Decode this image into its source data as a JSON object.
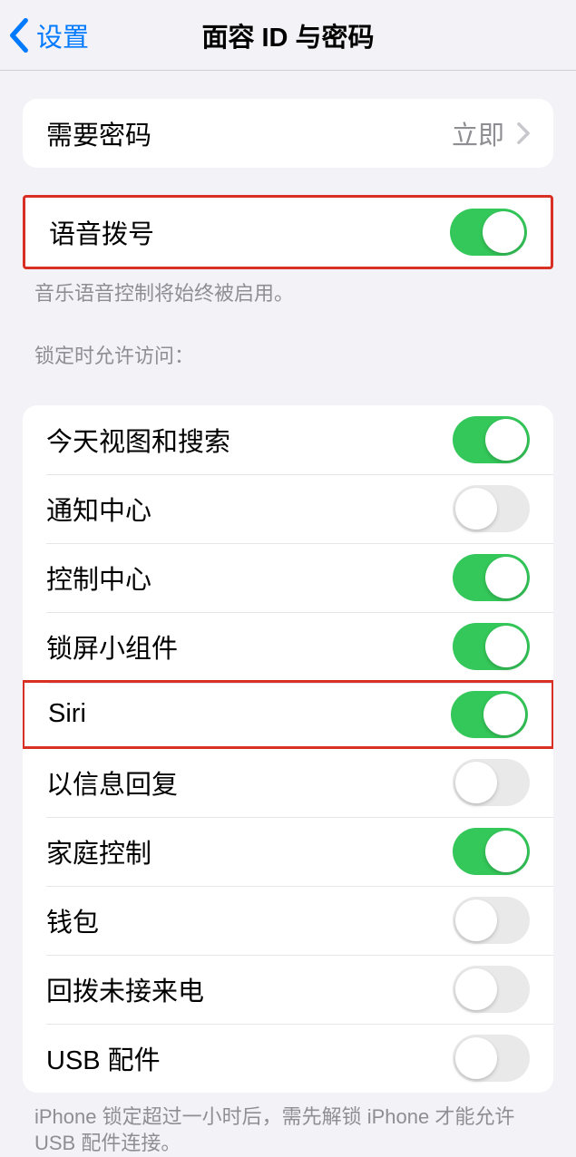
{
  "nav": {
    "back_label": "设置",
    "title": "面容 ID 与密码"
  },
  "require_passcode": {
    "label": "需要密码",
    "value": "立即"
  },
  "voice_dial": {
    "label": "语音拨号",
    "on": true,
    "footer": "音乐语音控制将始终被启用。"
  },
  "lock_access": {
    "header": "锁定时允许访问：",
    "items": [
      {
        "label": "今天视图和搜索",
        "on": true
      },
      {
        "label": "通知中心",
        "on": false
      },
      {
        "label": "控制中心",
        "on": true
      },
      {
        "label": "锁屏小组件",
        "on": true
      },
      {
        "label": "Siri",
        "on": true
      },
      {
        "label": "以信息回复",
        "on": false
      },
      {
        "label": "家庭控制",
        "on": true
      },
      {
        "label": "钱包",
        "on": false
      },
      {
        "label": "回拨未接来电",
        "on": false
      },
      {
        "label": "USB 配件",
        "on": false
      }
    ],
    "footer": "iPhone 锁定超过一小时后，需先解锁 iPhone 才能允许 USB 配件连接。"
  },
  "highlighted_rows": [
    "语音拨号",
    "Siri"
  ]
}
